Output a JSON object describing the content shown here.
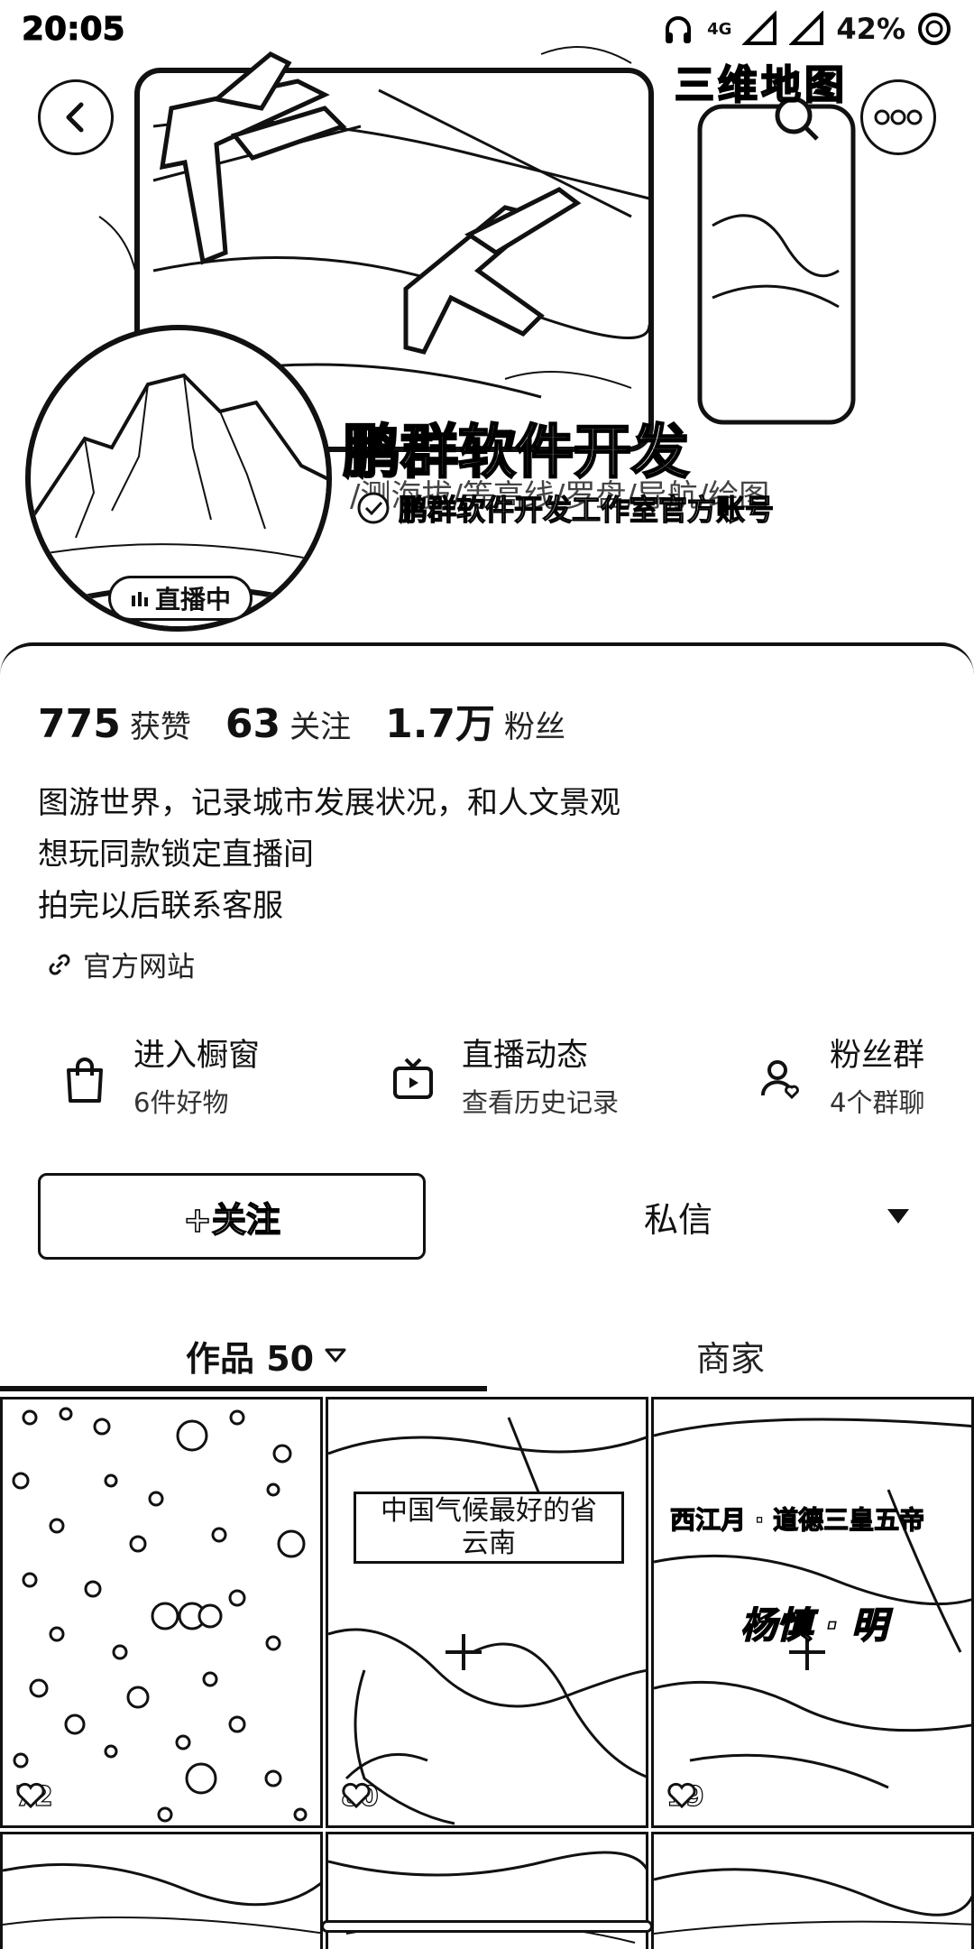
{
  "status_bar": {
    "time": "20:05",
    "network": "4G",
    "battery": "42%",
    "icons": [
      "headphone-icon",
      "signal-icon",
      "battery-icon"
    ]
  },
  "header": {
    "map3d_label": "三维地图",
    "nickname": "鹏群软件开发",
    "tagline": "/测海拔/等高线/罗盘/导航/绘图",
    "verified_text": "鹏群软件开发工作室官方账号",
    "live_badge": "直播中"
  },
  "stats": [
    {
      "value": "775",
      "label": "获赞"
    },
    {
      "value": "63",
      "label": "关注"
    },
    {
      "value": "1.7万",
      "label": "粉丝"
    }
  ],
  "bio": {
    "lines": [
      "图游世界，记录城市发展状况，和人文景观",
      "想玩同款锁定直播间",
      "拍完以后联系客服"
    ],
    "website": "官方网站"
  },
  "features": [
    {
      "title": "进入橱窗",
      "subtitle": "6件好物",
      "icon": "shopping-bag-icon"
    },
    {
      "title": "直播动态",
      "subtitle": "查看历史记录",
      "icon": "tv-icon"
    },
    {
      "title": "粉丝群",
      "subtitle": "4个群聊",
      "icon": "fan-group-icon"
    }
  ],
  "actions": {
    "follow": "+关注",
    "message": "私信"
  },
  "tabs": {
    "works": "作品 50",
    "merchant": "商家"
  },
  "posts": [
    {
      "likes": "72"
    },
    {
      "likes": "80",
      "caption_line1": "中国气候最好的省",
      "caption_line2": "云南"
    },
    {
      "likes": "19",
      "title": "西江月 · 道德三皇五帝",
      "stamp": "杨慎 · 明"
    }
  ]
}
